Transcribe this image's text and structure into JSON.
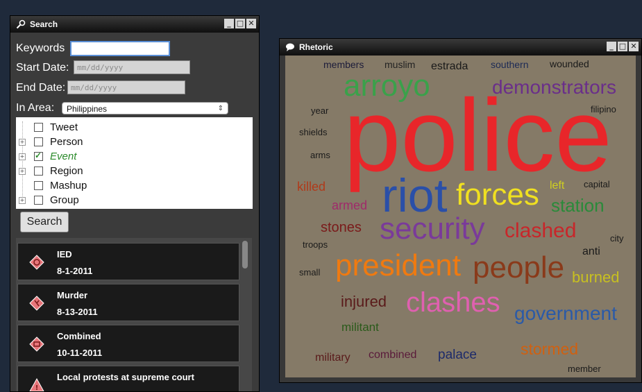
{
  "search_window": {
    "title": "Search",
    "keywords_label": "Keywords",
    "keywords_value": "",
    "start_date_label": "Start Date:",
    "start_date_placeholder": "mm/dd/yyyy",
    "end_date_label": "End Date:",
    "end_date_placeholder": "mm/dd/yyyy",
    "area_label": "In Area:",
    "area_value": "Philippines",
    "tree_items": [
      {
        "label": "Tweet",
        "checked": false,
        "expandable": false
      },
      {
        "label": "Person",
        "checked": false,
        "expandable": true
      },
      {
        "label": "Event",
        "checked": true,
        "expandable": true
      },
      {
        "label": "Region",
        "checked": false,
        "expandable": true
      },
      {
        "label": "Mashup",
        "checked": false,
        "expandable": false
      },
      {
        "label": "Group",
        "checked": false,
        "expandable": true
      }
    ],
    "search_button": "Search",
    "results": [
      {
        "title": "IED",
        "date": "8-1-2011",
        "icon": "ied-hazard-icon"
      },
      {
        "title": "Murder",
        "date": "8-13-2011",
        "icon": "murder-hazard-icon"
      },
      {
        "title": "Combined",
        "date": "10-11-2011",
        "icon": "combined-hazard-icon"
      },
      {
        "title": "Local protests at supreme court",
        "date": "",
        "icon": "protest-warning-icon"
      }
    ]
  },
  "rhetoric_window": {
    "title": "Rhetoric",
    "words": [
      {
        "text": "members",
        "color": "#1c1c3a"
      },
      {
        "text": "muslim",
        "color": "#222222"
      },
      {
        "text": "estrada",
        "color": "#1a1a1a"
      },
      {
        "text": "southern",
        "color": "#1c2a55"
      },
      {
        "text": "wounded",
        "color": "#1a1a1a"
      },
      {
        "text": "arroyo",
        "color": "#3aa14a"
      },
      {
        "text": "demonstrators",
        "color": "#6a2e8a"
      },
      {
        "text": "year",
        "color": "#1a1a1a"
      },
      {
        "text": "filipino",
        "color": "#1a1a1a"
      },
      {
        "text": "police",
        "color": "#e8262a"
      },
      {
        "text": "shields",
        "color": "#1a1a1a"
      },
      {
        "text": "arms",
        "color": "#1a1a1a"
      },
      {
        "text": "killed",
        "color": "#b03a1a"
      },
      {
        "text": "riot",
        "color": "#2a4fa8"
      },
      {
        "text": "forces",
        "color": "#f0e020"
      },
      {
        "text": "left",
        "color": "#d0d020"
      },
      {
        "text": "capital",
        "color": "#1a1a1a"
      },
      {
        "text": "station",
        "color": "#2a8a3a"
      },
      {
        "text": "armed",
        "color": "#a02a6a"
      },
      {
        "text": "stones",
        "color": "#7a1a1a"
      },
      {
        "text": "security",
        "color": "#7a3a9a"
      },
      {
        "text": "clashed",
        "color": "#c8262a"
      },
      {
        "text": "city",
        "color": "#1a1a1a"
      },
      {
        "text": "troops",
        "color": "#1a1a1a"
      },
      {
        "text": "anti",
        "color": "#1a1a1a"
      },
      {
        "text": "president",
        "color": "#f07a10"
      },
      {
        "text": "people",
        "color": "#8a3a1a"
      },
      {
        "text": "small",
        "color": "#1a1a1a"
      },
      {
        "text": "burned",
        "color": "#c8c020"
      },
      {
        "text": "injured",
        "color": "#5a1a1a"
      },
      {
        "text": "clashes",
        "color": "#e060b0"
      },
      {
        "text": "government",
        "color": "#2a5aa8"
      },
      {
        "text": "militant",
        "color": "#2a5a1a"
      },
      {
        "text": "stormed",
        "color": "#d06010"
      },
      {
        "text": "military",
        "color": "#5a1a1a"
      },
      {
        "text": "combined",
        "color": "#5a1a3a"
      },
      {
        "text": "palace",
        "color": "#1c2a6a"
      },
      {
        "text": "member",
        "color": "#1a1a1a"
      }
    ]
  },
  "window_controls": {
    "minimize": "_",
    "maximize": "□",
    "close": "✕"
  }
}
